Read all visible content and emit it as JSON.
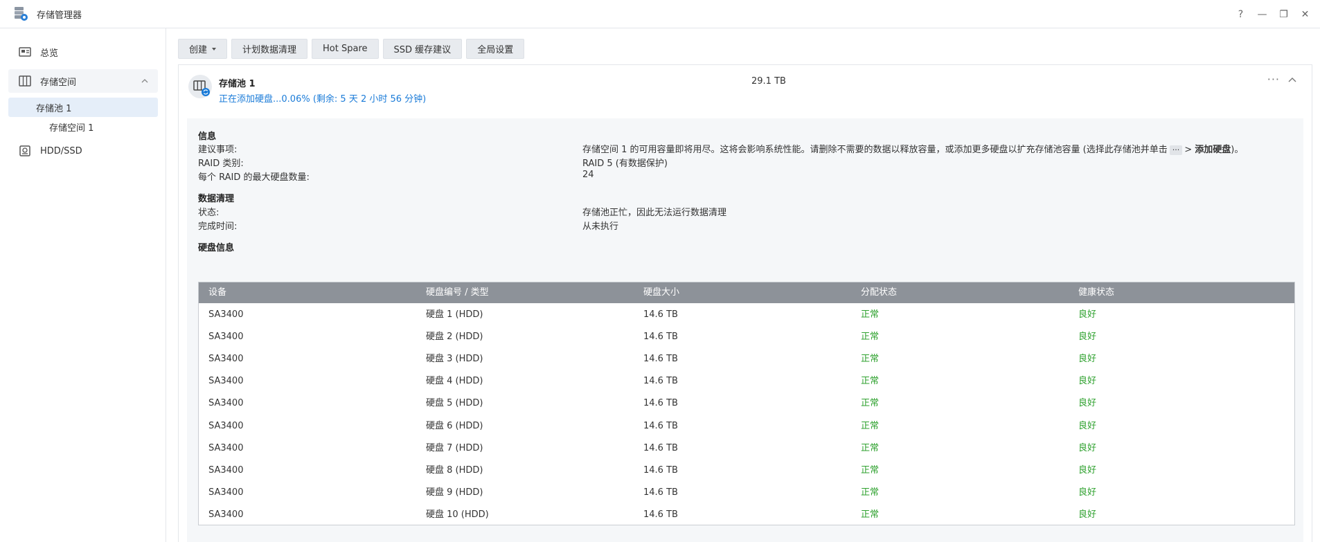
{
  "window": {
    "title": "存储管理器",
    "controls": [
      "?",
      "—",
      "❐",
      "✕"
    ]
  },
  "sidebar": {
    "overview": "总览",
    "storage_space": "存储空间",
    "pool_item": "存储池 1",
    "volume_item": "存储空间 1",
    "hdd_ssd": "HDD/SSD"
  },
  "toolbar": {
    "create": "创建",
    "data_scrub": "计划数据清理",
    "hot_spare": "Hot Spare",
    "ssd_cache": "SSD 缓存建议",
    "global_settings": "全局设置"
  },
  "pool": {
    "name": "存储池 1",
    "status": "正在添加硬盘...0.06% (剩余: 5 天 2 小时 56 分钟)",
    "size": "29.1 TB",
    "more": "···"
  },
  "info": {
    "title": "信息",
    "suggestion_label": "建议事项:",
    "suggestion_value_pre": "存储空间 1 的可用容量即将用尽。这将会影响系统性能。请删除不需要的数据以释放容量，或添加更多硬盘以扩充存储池容量 (选择此存储池并单击",
    "suggestion_kbd": "···",
    "suggestion_value_mid": "> ",
    "suggestion_value_bold": "添加硬盘",
    "suggestion_value_post": ")。",
    "raid_label": "RAID 类别:",
    "raid_value": "RAID 5 (有数据保护)",
    "max_disks_label": "每个 RAID 的最大硬盘数量:",
    "max_disks_value": "24"
  },
  "scrub": {
    "title": "数据清理",
    "state_label": "状态:",
    "state_value": "存储池正忙，因此无法运行数据清理",
    "finish_label": "完成时间:",
    "finish_value": "从未执行"
  },
  "disks": {
    "title": "硬盘信息",
    "headers": [
      "设备",
      "硬盘编号 / 类型",
      "硬盘大小",
      "分配状态",
      "健康状态"
    ],
    "rows": [
      [
        "SA3400",
        "硬盘 1 (HDD)",
        "14.6 TB",
        "正常",
        "良好"
      ],
      [
        "SA3400",
        "硬盘 2 (HDD)",
        "14.6 TB",
        "正常",
        "良好"
      ],
      [
        "SA3400",
        "硬盘 3 (HDD)",
        "14.6 TB",
        "正常",
        "良好"
      ],
      [
        "SA3400",
        "硬盘 4 (HDD)",
        "14.6 TB",
        "正常",
        "良好"
      ],
      [
        "SA3400",
        "硬盘 5 (HDD)",
        "14.6 TB",
        "正常",
        "良好"
      ],
      [
        "SA3400",
        "硬盘 6 (HDD)",
        "14.6 TB",
        "正常",
        "良好"
      ],
      [
        "SA3400",
        "硬盘 7 (HDD)",
        "14.6 TB",
        "正常",
        "良好"
      ],
      [
        "SA3400",
        "硬盘 8 (HDD)",
        "14.6 TB",
        "正常",
        "良好"
      ],
      [
        "SA3400",
        "硬盘 9 (HDD)",
        "14.6 TB",
        "正常",
        "良好"
      ],
      [
        "SA3400",
        "硬盘 10 (HDD)",
        "14.6 TB",
        "正常",
        "良好"
      ]
    ]
  },
  "colors": {
    "accent": "#1a7bd8",
    "ok": "#2ea12e",
    "table_header": "#8d9299"
  }
}
